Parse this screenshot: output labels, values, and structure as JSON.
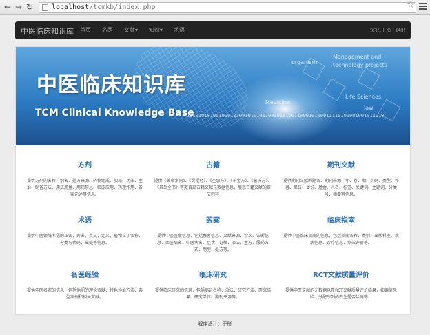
{
  "browser": {
    "url_host": "localhost",
    "url_path": "/tcmkb/index.php"
  },
  "navbar": {
    "brand": "中医临床知识库",
    "links": [
      "首页",
      "名医",
      "文献▾",
      "知识▾",
      "术语"
    ],
    "user": "您好,于彤 | 退出"
  },
  "banner": {
    "title_cn": "中医临床知识库",
    "title_en": "TCM Clinical Knowledge Base",
    "binary": "10101010100101010100101010110010101101100010100011110101001001011010",
    "keywords": [
      "organism",
      "Management and",
      "technology projects",
      "Life Sciences",
      "law",
      "Medicine"
    ]
  },
  "sections": [
    {
      "title": "方剂",
      "desc": "提供方剂的名称、别名、处方来源、药物组成、加减、功效、主治、制备方法、用法用量、用药禁忌、临床应用、药理作用、各家论述等信息。"
    },
    {
      "title": "古籍",
      "desc": "提供《黄帝素问》、《灵枢经》、《圣惠方》、《千金方》、《普济方》、《景岳全书》等数百部古籍文献元数据信息，展示古籍文献的章节内容"
    },
    {
      "title": "期刊文献",
      "desc": "提供期刊文献的题名、期刊来源、年、卷、期、页码、类型、作者、单位、省份、基金、人名、标签、关键词、主题词、分类号、摘要等信息。"
    },
    {
      "title": "术语",
      "desc": "提供中医领域术语的正名，异名，英文，定义，植物拉丁名称，分类与代码，出处等信息。"
    },
    {
      "title": "医案",
      "desc": "提供中医医案信息，包括患者信息、文献来源、诊次、诊断信息、西医病名、中医病名、症状、证候、治法、主方、服药方式、剂型、处方等。"
    },
    {
      "title": "临床指南",
      "desc": "提供中医临床指南的信息，包括指南名称、类别、出版科室、疾病信息、诊疗信息、疗效评价等。"
    },
    {
      "title": "名医经验",
      "desc": "提供中医名家的信息，包括他们的理论贡献、特色诊治方法、典型案例和相关文献。"
    },
    {
      "title": "临床研究",
      "desc": "提供临床研究的信息，包括病证名称、治法、研究方法、研究结果、研究单位、期刊来源等。"
    },
    {
      "title": "RCT文献质量评价",
      "desc": "提供中医文献的元数据以及RCT文献质量评价结果，如偏倚风险、分配序列的产生是否恰当等。"
    }
  ],
  "footer": "程序设计：于彤"
}
